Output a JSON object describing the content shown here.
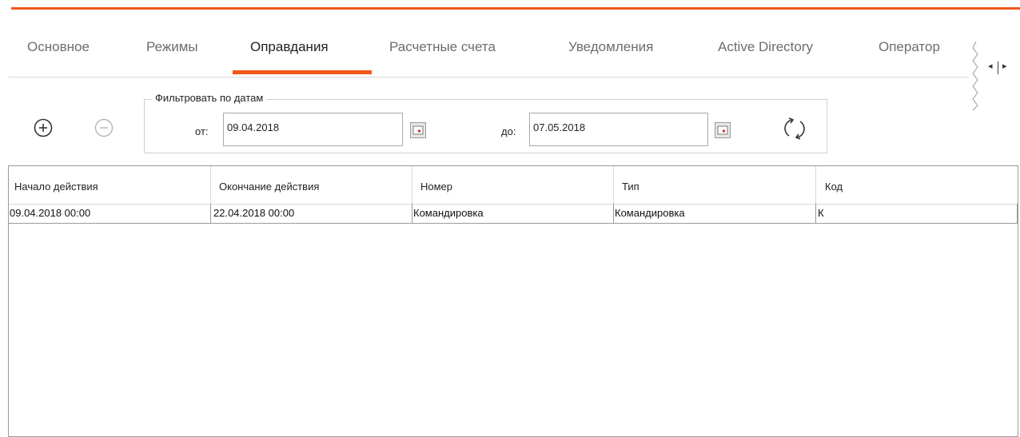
{
  "tabs": [
    {
      "label": "Основное"
    },
    {
      "label": "Режимы"
    },
    {
      "label": "Оправдания",
      "active": true
    },
    {
      "label": "Расчетные счета"
    },
    {
      "label": "Уведомления"
    },
    {
      "label": "Active Directory"
    },
    {
      "label": "Оператор"
    }
  ],
  "tab_scroll": {
    "left_icon": "triangle-left",
    "right_icon": "triangle-right"
  },
  "toolbar": {
    "add_icon": "plus-circle-icon",
    "remove_icon": "minus-circle-icon"
  },
  "filter": {
    "legend": "Фильтровать по датам",
    "from_label": "от:",
    "from_value": "09.04.2018",
    "to_label": "до:",
    "to_value": "07.05.2018",
    "calendar_icon": "calendar-icon",
    "refresh_icon": "refresh-icon"
  },
  "table": {
    "columns": [
      "Начало действия",
      "Окончание действия",
      "Номер",
      "Тип",
      "Код"
    ],
    "rows": [
      [
        "09.04.2018 00:00",
        "22.04.2018 00:00",
        "Командировка",
        "Командировка",
        "К"
      ]
    ]
  },
  "colors": {
    "accent": "#f0571b",
    "text": "#222222",
    "muted_tab": "#6d6d6d"
  }
}
